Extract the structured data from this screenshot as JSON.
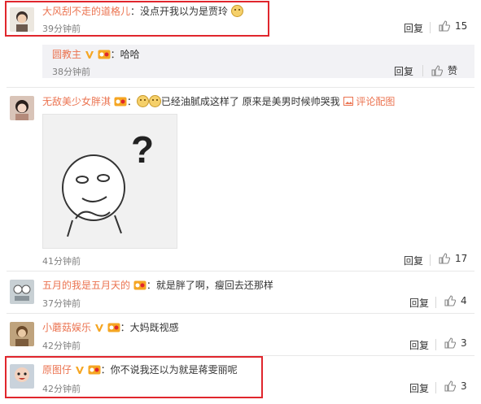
{
  "comments": [
    {
      "username": "大风刮不走的道格儿",
      "text": "：没点开我以为是贾玲",
      "time": "39分钟前",
      "reply_label": "回复",
      "likes": "15",
      "highlighted": true
    },
    {
      "username": "圆教主",
      "text": "：哈哈",
      "time": "38分钟前",
      "reply_label": "回复",
      "like_label": "赞",
      "is_nested_reply": true
    },
    {
      "username": "无敌美少女胖淇",
      "text": "已经油腻成这样了 原来是美男时候帅哭我",
      "pic_link": "评论配图",
      "time": "41分钟前",
      "reply_label": "回复",
      "likes": "17",
      "image_glyph": "?"
    },
    {
      "username": "五月的我是五月天的",
      "text": "：就是胖了啊，瘦回去还那样",
      "time": "37分钟前",
      "reply_label": "回复",
      "likes": "4"
    },
    {
      "username": "小蘑菇娱乐",
      "text": "：大妈既视感",
      "time": "42分钟前",
      "reply_label": "回复",
      "likes": "3"
    },
    {
      "username": "原图仔",
      "text": "：你不说我还以为就是蒋雯丽呢",
      "time": "42分钟前",
      "reply_label": "回复",
      "likes": "3",
      "highlighted": true
    }
  ],
  "colors": {
    "username": "#eb7350",
    "highlight": "#e0262d",
    "reply_bg": "#f2f2f5",
    "divider": "#e8e8e8"
  }
}
